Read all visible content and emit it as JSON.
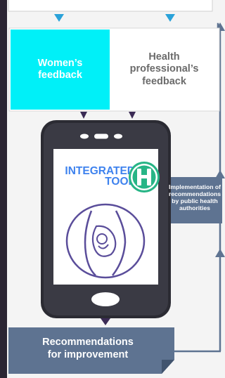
{
  "feedback": {
    "women": "Women’s feedback",
    "health": "Health professional’s feedback"
  },
  "tool": {
    "line1": "INTEGRATED",
    "line2": "TOOL",
    "logo_icon": "h-letter-logo-icon",
    "illustration_icon": "pregnant-woman-icon"
  },
  "implementation": "Implementation of recommendations by public health authorities",
  "recommendations": "Recommendations for improvement",
  "colors": {
    "cyan": "#00f0f8",
    "arrow_blue": "#2aa2d9",
    "dark_purple": "#3b2b55",
    "phone_dark": "#2b2b33",
    "slate": "#5e7391",
    "tool_blue": "#3e82ee",
    "logo_green": "#27b586",
    "illustration_purple": "#5a4d9a"
  }
}
